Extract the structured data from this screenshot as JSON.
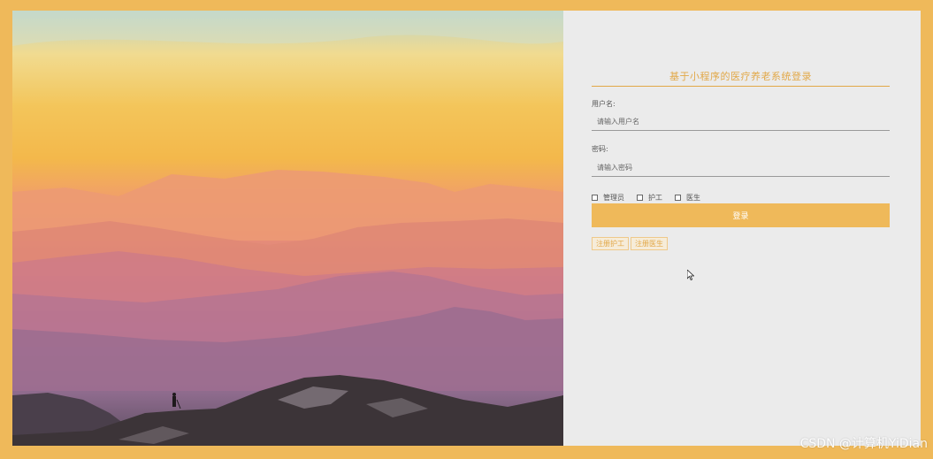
{
  "login": {
    "title": "基于小程序的医疗养老系统登录",
    "username_label": "用户名:",
    "username_placeholder": "请输入用户名",
    "password_label": "密码:",
    "password_placeholder": "请输入密码",
    "roles": [
      {
        "label": "管理员"
      },
      {
        "label": "护工"
      },
      {
        "label": "医生"
      }
    ],
    "login_button": "登录",
    "register_links": [
      {
        "label": "注册护工"
      },
      {
        "label": "注册医生"
      }
    ]
  },
  "watermark": "CSDN @计算机YiDian",
  "colors": {
    "accent": "#efb95a",
    "panel_bg": "#ebebeb",
    "title_color": "#e2a848"
  },
  "icons": {
    "cursor": "mouse-pointer-icon"
  }
}
